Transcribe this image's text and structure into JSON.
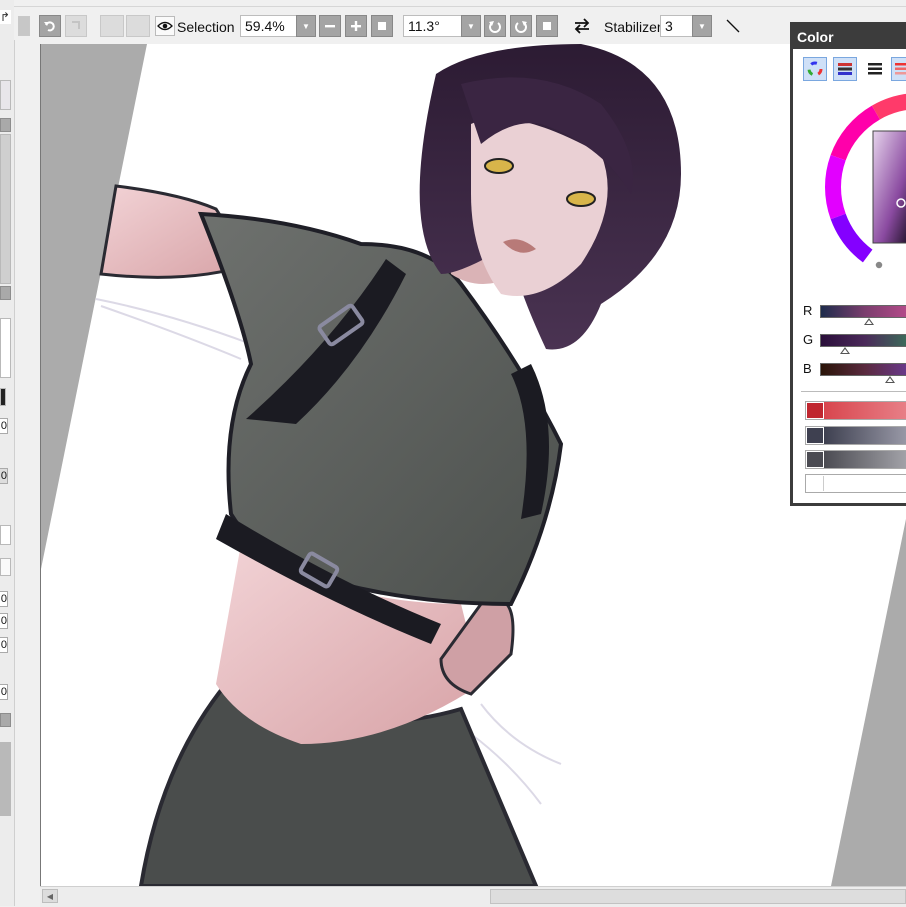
{
  "toolbar": {
    "selection_label": "Selection",
    "zoom_value": "59.4%",
    "rotation_value": "11.3°",
    "stabilizer_label": "Stabilizer",
    "stabilizer_value": "3"
  },
  "left_strip": {
    "fields": [
      "0",
      "0",
      "0",
      "0",
      "0",
      "0"
    ]
  },
  "color_panel": {
    "title": "Color",
    "tabs": [
      "color-wheel-icon",
      "rgb-sliders-icon",
      "hsv-sliders-icon",
      "palette-icon"
    ],
    "sliders": [
      {
        "label": "R",
        "value": 0.34,
        "gradient": [
          "#1e2c4c",
          "#7b3e6e",
          "#b64b8a"
        ]
      },
      {
        "label": "G",
        "value": 0.2,
        "gradient": [
          "#2a0e3a",
          "#4b2a5a",
          "#3c6e5a"
        ]
      },
      {
        "label": "B",
        "value": 0.5,
        "gradient": [
          "#2a1408",
          "#5a2a3e",
          "#6a3a8e"
        ]
      }
    ],
    "swatch_colors": [
      "#c0262f",
      "#3e4050",
      "#4b4b52",
      "#ffffff"
    ]
  },
  "colors": {
    "accent": "#3c3c3c",
    "canvas_bg": "#ababab",
    "selection_tab": "#cfe0f7"
  }
}
